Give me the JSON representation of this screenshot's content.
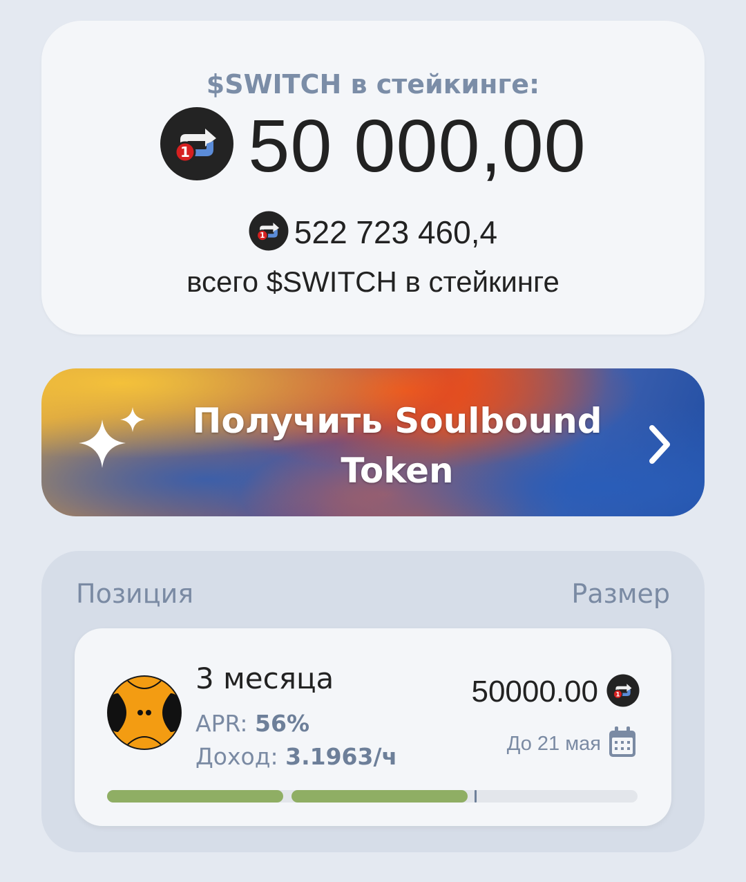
{
  "staking": {
    "title": "$SWITCH в стейкинге:",
    "amount": "50 000,00",
    "total_amount": "522 723 460,4",
    "total_caption": "всего $SWITCH в стейкинге",
    "token_badge": "1"
  },
  "banner": {
    "label": "Получить Soulbound Token"
  },
  "positions": {
    "header_left": "Позиция",
    "header_right": "Размер",
    "items": [
      {
        "title": "3 месяца",
        "apr_label": "APR:",
        "apr_value": "56%",
        "income_label": "Доход:",
        "income_value": "3.1963/ч",
        "size": "50000.00",
        "until": "До 21 мая",
        "progress_percent": 68
      }
    ]
  },
  "colors": {
    "accent_muted": "#7a8aa3",
    "progress_fill": "#8fae64",
    "progress_track": "#e3e6eb",
    "page_bg": "#e4e9f1"
  },
  "icons": [
    "switch-token-icon",
    "sparkle-icon",
    "chevron-right-icon",
    "calendar-icon",
    "avatar-face-icon"
  ]
}
